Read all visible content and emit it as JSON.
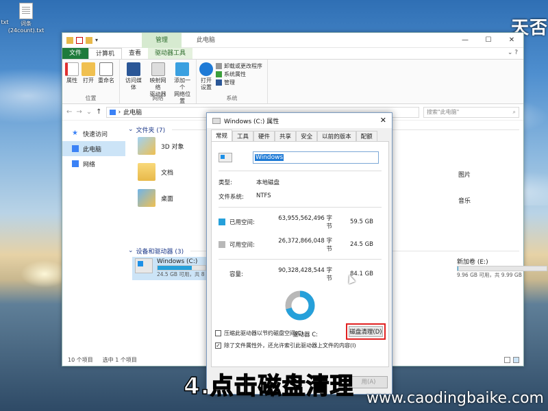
{
  "desktop": {
    "icons": [
      {
        "label": "txt"
      },
      {
        "label": "词条\n(24count).txt"
      }
    ],
    "brand_top": "天否",
    "caption": "4.点击磁盘清理",
    "watermark": "www.caodingbaike.com"
  },
  "explorer": {
    "title": "此电脑",
    "manage_tab": "管理",
    "tabs": [
      {
        "label": "文件",
        "kind": "file"
      },
      {
        "label": "计算机",
        "kind": "active"
      },
      {
        "label": "查看",
        "kind": "normal"
      },
      {
        "label": "驱动器工具",
        "kind": "drive"
      }
    ],
    "window_controls": [
      "—",
      "☐",
      "✕"
    ],
    "ribbon": {
      "location_group": {
        "label": "位置",
        "buttons": [
          "属性",
          "打开",
          "重命名"
        ]
      },
      "network_group": {
        "label": "网络",
        "buttons": [
          "访问媒体",
          "映射网络\n驱动器",
          "添加一个\n网络位置"
        ]
      },
      "system_group": {
        "label": "系统",
        "big_button": "打开\n设置",
        "small": [
          "卸载或更改程序",
          "系统属性",
          "管理"
        ]
      }
    },
    "address": {
      "path": "此电脑",
      "search_placeholder": "搜索\"此电脑\""
    },
    "sidebar": [
      {
        "label": "快速访问",
        "icon": "star-icon",
        "color": "#3b82f6"
      },
      {
        "label": "此电脑",
        "icon": "computer-icon",
        "color": "#3b82f6",
        "selected": true
      },
      {
        "label": "网络",
        "icon": "network-icon",
        "color": "#3b82f6"
      }
    ],
    "folders_header": "文件夹 (7)",
    "folders": [
      "3D 对象",
      "文档",
      "桌面",
      "图片",
      "音乐"
    ],
    "drives_header": "设备和驱动器 (3)",
    "drives": [
      {
        "name": "Windows (C:)",
        "free": "24.5 GB 可用，共 8",
        "used_fraction": 0.71
      },
      {
        "name": "新加卷 (E:)",
        "free": "9.96 GB 可用，共 9.99 GB",
        "used_fraction": 0.003
      }
    ],
    "status": {
      "count": "10 个项目",
      "selected": "选中 1 个项目"
    }
  },
  "dialog": {
    "title": "Windows (C:) 属性",
    "tabs": [
      "常规",
      "工具",
      "硬件",
      "共享",
      "安全",
      "以前的版本",
      "配额"
    ],
    "active_tab": "常规",
    "name_value": "Windows",
    "type_label": "类型:",
    "type_value": "本地磁盘",
    "fs_label": "文件系统:",
    "fs_value": "NTFS",
    "used": {
      "label": "已用空间:",
      "bytes": "63,955,562,496 字节",
      "gb": "59.5 GB",
      "color": "#26a0da"
    },
    "free": {
      "label": "可用空间:",
      "bytes": "26,372,866,048 字节",
      "gb": "24.5 GB",
      "color": "#b8b8b8"
    },
    "capacity": {
      "label": "容量:",
      "bytes": "90,328,428,544 字节",
      "gb": "84.1 GB"
    },
    "used_fraction": 0.708,
    "drive_label": "驱动器 C:",
    "cleanup_button": "磁盘清理(D)",
    "highlight_color": "#e02020",
    "checkboxes": [
      {
        "label": "压缩此驱动器以节约磁盘空间(C)",
        "checked": false
      },
      {
        "label": "除了文件属性外，还允许索引此驱动器上文件的内容(I)",
        "checked": true
      }
    ],
    "footer_buttons": [
      "用(A)"
    ]
  }
}
